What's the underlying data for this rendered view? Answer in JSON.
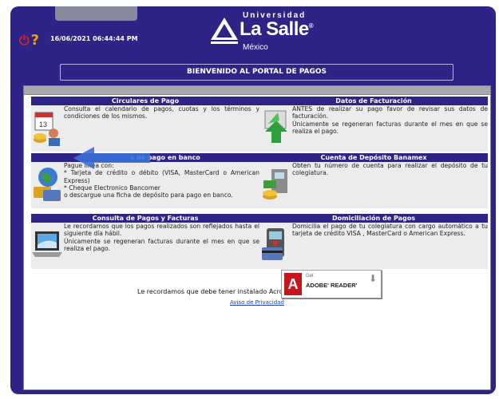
{
  "header": {
    "datetime": "16/06/2021 06:44:44 PM",
    "logo_top": "Universidad",
    "logo_brand": "La Salle",
    "logo_sub": "México"
  },
  "welcome": "BIENVENIDO AL PORTAL DE PAGOS",
  "cards": [
    {
      "title": "Circulares de Pago",
      "lines": [
        "Consulta el calendario de pagos, cuotas y los términos y condiciones de los mismos."
      ],
      "icon": "calendar-coins-icon"
    },
    {
      "title": "Datos de Facturación",
      "lines": [
        "ANTES de realizar su pago favor de revisar sus datos de facturación.",
        "Únicamente se regeneran facturas durante el mes en que se realiza el pago."
      ],
      "icon": "recycle-arrows-icon"
    },
    {
      "title": "s de pago en banco",
      "lines": [
        "Pague  línea con:",
        "* Tarjeta de crédito o débito (VISA, MasterCard o American Express)",
        "* Cheque Electronico Bancomer",
        "o descargue una ficha de depósito para pago en banco."
      ],
      "icon": "globe-cards-icon"
    },
    {
      "title": "Cuenta de Depósito Banamex",
      "lines": [
        "Obten tu número de cuenta para realizar el depósito de tu colegiatura."
      ],
      "icon": "bank-deposit-icon"
    },
    {
      "title": "Consulta de Pagos y Facturas",
      "lines": [
        "Le recordamos que los pagos realizados son reflejados hasta el siguiente día hábil.",
        "Únicamente se regeneran facturas durante el mes en que se realiza el pago."
      ],
      "icon": "laptop-icon"
    },
    {
      "title": "Domiciliación de Pagos",
      "lines": [
        "Domicilia el pago de tu colegiatura con cargo automático a tu tarjeta de crédito VISA , MasterCard o American Express."
      ],
      "icon": "card-reader-icon"
    }
  ],
  "footer": {
    "acrobat_text": "Le recordamos que debe tener instalado Acrobat Reader.",
    "privacy_link": "Aviso de Privacidad",
    "adobe_get": "Get",
    "adobe_reader": "ADOBE' READER'"
  },
  "colors": {
    "primary": "#2e2486",
    "card_bg": "#ececec",
    "link": "#1a3fb5"
  }
}
